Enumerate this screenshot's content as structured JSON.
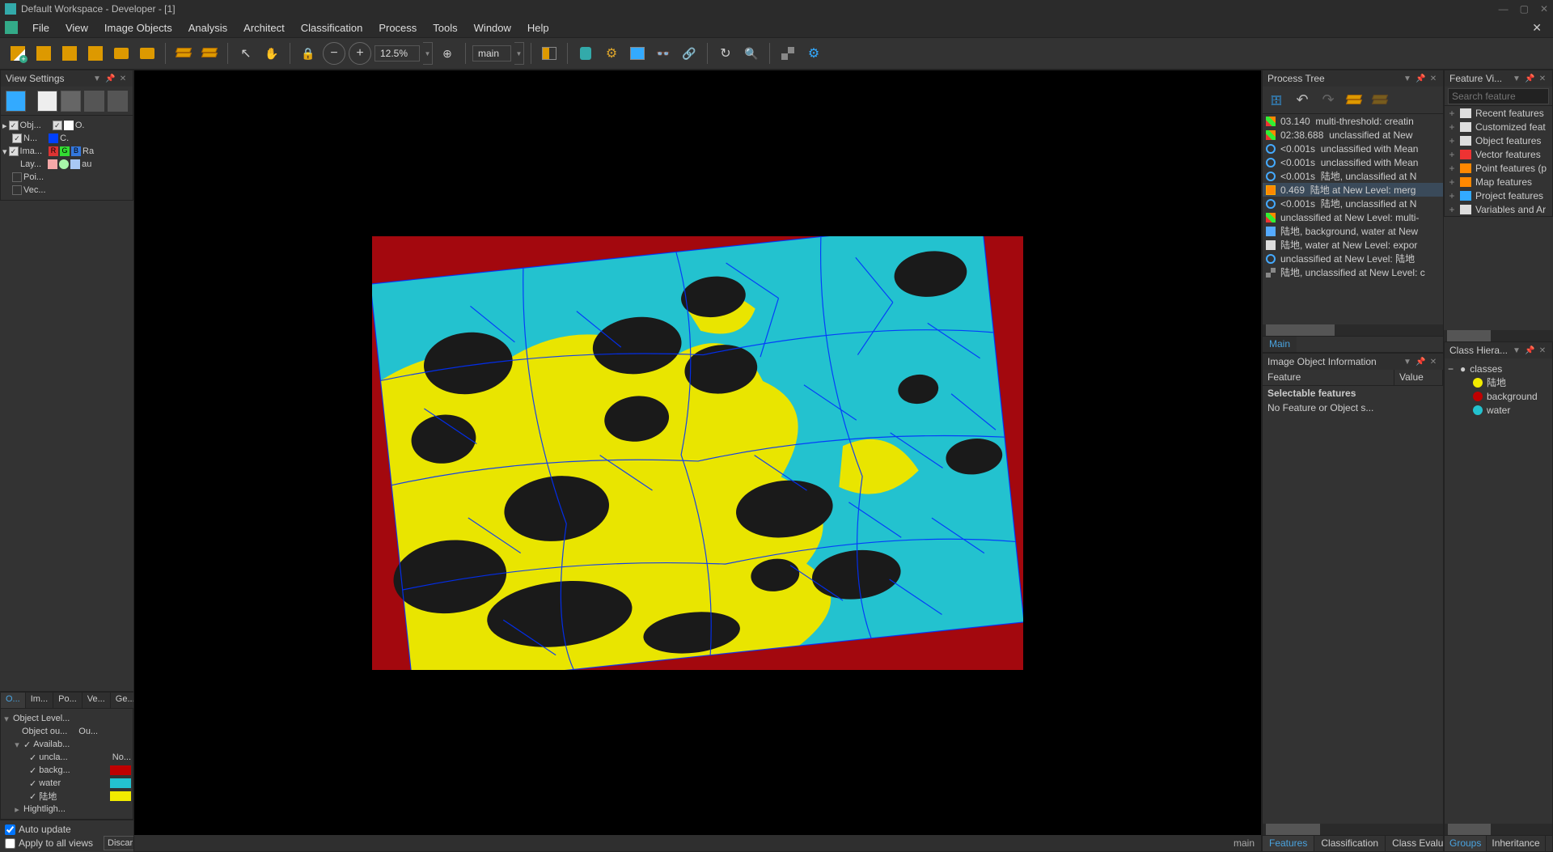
{
  "titlebar": {
    "title": "Default Workspace - Developer - [1]"
  },
  "menubar": {
    "items": [
      "File",
      "View",
      "Image Objects",
      "Analysis",
      "Architect",
      "Classification",
      "Process",
      "Tools",
      "Window",
      "Help"
    ]
  },
  "toolbar": {
    "zoom": "12.5%",
    "target": "main"
  },
  "view_settings": {
    "title": "View Settings",
    "layers_top": {
      "obj": "Obj...",
      "o_col": "O.",
      "n": "N...",
      "c_col": "C.",
      "ima": "Ima...",
      "ra": "Ra",
      "lay": "Lay...",
      "au": "au",
      "poi": "Poi...",
      "vec": "Vec..."
    },
    "tabs": [
      "O...",
      "Im...",
      "Po...",
      "Ve...",
      "Ge..."
    ],
    "object_level": {
      "root": "Object Level...",
      "ou1": "Object ou...",
      "ou2": "Ou...",
      "avail": "Availab...",
      "items": [
        {
          "label": "uncla...",
          "right": "No..."
        },
        {
          "label": "backg...",
          "color": "#c00000"
        },
        {
          "label": "water",
          "color": "#23c2cf"
        },
        {
          "label": "陆地",
          "color": "#f1eb00"
        }
      ],
      "highlight": "Hightligh..."
    },
    "auto_update": "Auto update",
    "apply_all": "Apply to all views",
    "discard": "Discar"
  },
  "canvas": {
    "status_target": "main"
  },
  "process_tree": {
    "title": "Process Tree",
    "items": [
      {
        "icon": "multi",
        "time": "03.140",
        "text": "multi-threshold: creatin"
      },
      {
        "icon": "multi",
        "time": "02:38.688",
        "text": "unclassified at  New "
      },
      {
        "icon": "circle",
        "time": "<0.001s",
        "text": "unclassified with Mean"
      },
      {
        "icon": "circle",
        "time": "<0.001s",
        "text": "unclassified with Mean"
      },
      {
        "icon": "circle",
        "time": "<0.001s",
        "text": "陆地, unclassified at  N"
      },
      {
        "icon": "merge",
        "time": "0.469",
        "text": "陆地 at  New Level: merg",
        "sel": true
      },
      {
        "icon": "circle",
        "time": "<0.001s",
        "text": "陆地, unclassified at  N"
      },
      {
        "icon": "multi",
        "time": "",
        "text": "unclassified at  New Level: multi-"
      },
      {
        "icon": "export",
        "time": "",
        "text": "陆地, background, water at  New"
      },
      {
        "icon": "export2",
        "time": "",
        "text": "陆地, water at  New Level: expor"
      },
      {
        "icon": "circle",
        "time": "",
        "text": "unclassified at  New Level: 陆地"
      },
      {
        "icon": "grid",
        "time": "",
        "text": "陆地, unclassified at  New Level: c"
      }
    ],
    "tab": "Main"
  },
  "image_object_info": {
    "title": "Image Object Information",
    "col1": "Feature",
    "col2": "Value",
    "section": "Selectable features",
    "empty": "No Feature or Object s...",
    "tabs": [
      "Features",
      "Classification",
      "Class Evalua"
    ]
  },
  "feature_view": {
    "title": "Feature Vi...",
    "placeholder": "Search feature",
    "items": [
      "Recent features",
      "Customized feat",
      "Object features",
      "Vector features",
      "Point features (p",
      "Map features",
      "Project features",
      "Variables and Ar"
    ]
  },
  "class_hierarchy": {
    "title": "Class Hiera...",
    "root": "classes",
    "items": [
      {
        "label": "陆地",
        "color": "#f1eb00"
      },
      {
        "label": "background",
        "color": "#c00000"
      },
      {
        "label": "water",
        "color": "#23c2cf"
      }
    ],
    "tabs": [
      "Groups",
      "Inheritance"
    ]
  }
}
